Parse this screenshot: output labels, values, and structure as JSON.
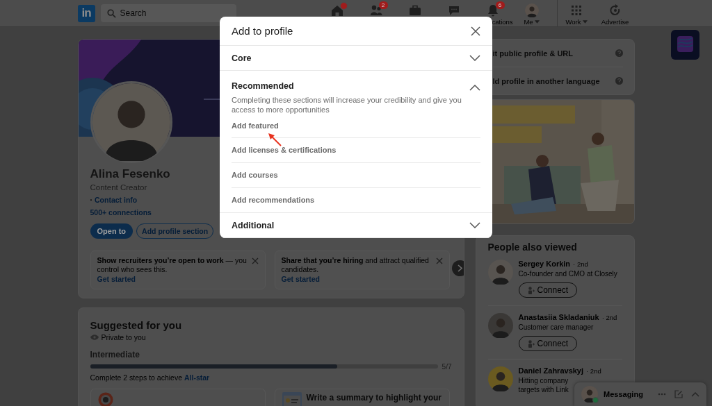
{
  "nav": {
    "logo": "in",
    "search_placeholder": "Search",
    "items": [
      {
        "kind": "home",
        "dot": true,
        "menu": false
      },
      {
        "kind": "network",
        "dot": false,
        "badge": "2",
        "menu": false
      },
      {
        "kind": "jobs",
        "dot": false,
        "menu": false
      },
      {
        "kind": "messaging",
        "dot": false,
        "menu": false
      },
      {
        "kind": "notifications",
        "dot": false,
        "badge": "6",
        "label": "cations",
        "menu": false
      },
      {
        "kind": "me",
        "dot": false,
        "label": "Me",
        "menu": true
      },
      {
        "kind": "work",
        "dot": false,
        "label": "Work",
        "menu": true
      },
      {
        "kind": "advertise",
        "dot": false,
        "label": "Advertise",
        "menu": false
      }
    ]
  },
  "profile": {
    "name": "Alina Fesenko",
    "headline": "Content Creator",
    "contact_prefix": "·",
    "contact": "Contact info",
    "connections": "500+ connections",
    "buttons": [
      {
        "kind": "primary",
        "label": "Open to"
      },
      {
        "kind": "outline",
        "label": "Add profile section"
      }
    ],
    "prompts": [
      {
        "text": "**Show recruiters you’re open to work** — you control who sees this.",
        "action": "Get started"
      },
      {
        "text": "**Share that you’re hiring** and attract qualified candidates.",
        "action": "Get started"
      }
    ]
  },
  "suggested": {
    "title": "Suggested for you",
    "privacy": "Private to you",
    "level_title": "Intermediate",
    "progress": {
      "level": 0.71,
      "reading": "5/7"
    },
    "hint": "Complete 2 steps to achieve",
    "hint_link": "All-star",
    "cards": [
      {
        "kind": "target"
      },
      {
        "kind": "summary",
        "title": "Write a summary to highlight your"
      }
    ]
  },
  "side": {
    "profile_links": [
      {
        "label": "it public profile & URL"
      },
      {
        "label": "ld profile in another language"
      }
    ],
    "people_title": "People also viewed",
    "people": [
      {
        "name": "Sergey Korkin",
        "degree": "· 2nd",
        "headline": "Co-founder and CMO at Closely",
        "action": "Connect"
      },
      {
        "name": "Anastasiia Skladaniuk",
        "degree": "· 2nd",
        "headline": "Customer care manager",
        "action": "Connect"
      },
      {
        "name": "Daniel Zahravskyj",
        "degree": "· 2nd",
        "headline": "Hitting company targets with Link"
      }
    ]
  },
  "modal": {
    "title": "Add to profile",
    "sections": [
      {
        "title": "Core",
        "expanded": false
      },
      {
        "title": "Recommended",
        "expanded": true,
        "description": "Completing these sections will increase your credibility and give you access to more opportunities",
        "items": [
          "Add featured",
          "Add licenses & certifications",
          "Add courses",
          "Add recommendations"
        ]
      },
      {
        "title": "Additional",
        "expanded": false
      }
    ]
  },
  "messaging": {
    "label": "Messaging",
    "online": true
  }
}
